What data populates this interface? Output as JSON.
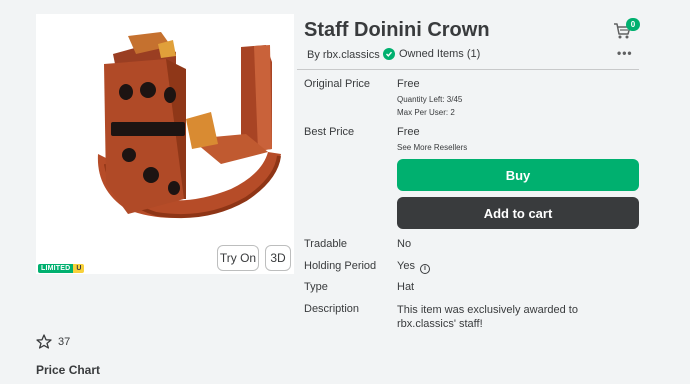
{
  "item": {
    "title": "Staff Doinini Crown",
    "byline": "By rbx.classics",
    "owned": "Owned Items (1)",
    "more": "•••",
    "limited_label": "LIMITED",
    "limited_u": "U"
  },
  "viewer": {
    "try_on": "Try On",
    "three_d": "3D"
  },
  "cart": {
    "count": "0"
  },
  "pricing": {
    "original_price_label": "Original Price",
    "original_price_value": "Free",
    "quantity_left": "Quantity Left: 3/45",
    "max_per_user": "Max Per User: 2",
    "best_price_label": "Best Price",
    "best_price_value": "Free",
    "see_more_resellers": "See More Resellers"
  },
  "actions": {
    "buy": "Buy",
    "add_to_cart": "Add to cart"
  },
  "details": [
    {
      "label": "Tradable",
      "value": "No"
    },
    {
      "label": "Holding Period",
      "value": "Yes"
    },
    {
      "label": "Type",
      "value": "Hat"
    },
    {
      "label": "Description",
      "value": "This item was exclusively awarded to rbx.classics' staff!"
    }
  ],
  "favorites": {
    "count": "37"
  },
  "sections": {
    "price_chart": "Price Chart"
  },
  "colors": {
    "accent_green": "#00b06f",
    "dark_button": "#393b3d",
    "crown_orange": "#b8502e"
  },
  "icons": {
    "cart": "cart-icon",
    "check": "check-circle-icon",
    "info": "info-icon",
    "star": "star-outline-icon",
    "more": "more-horizontal-icon"
  }
}
